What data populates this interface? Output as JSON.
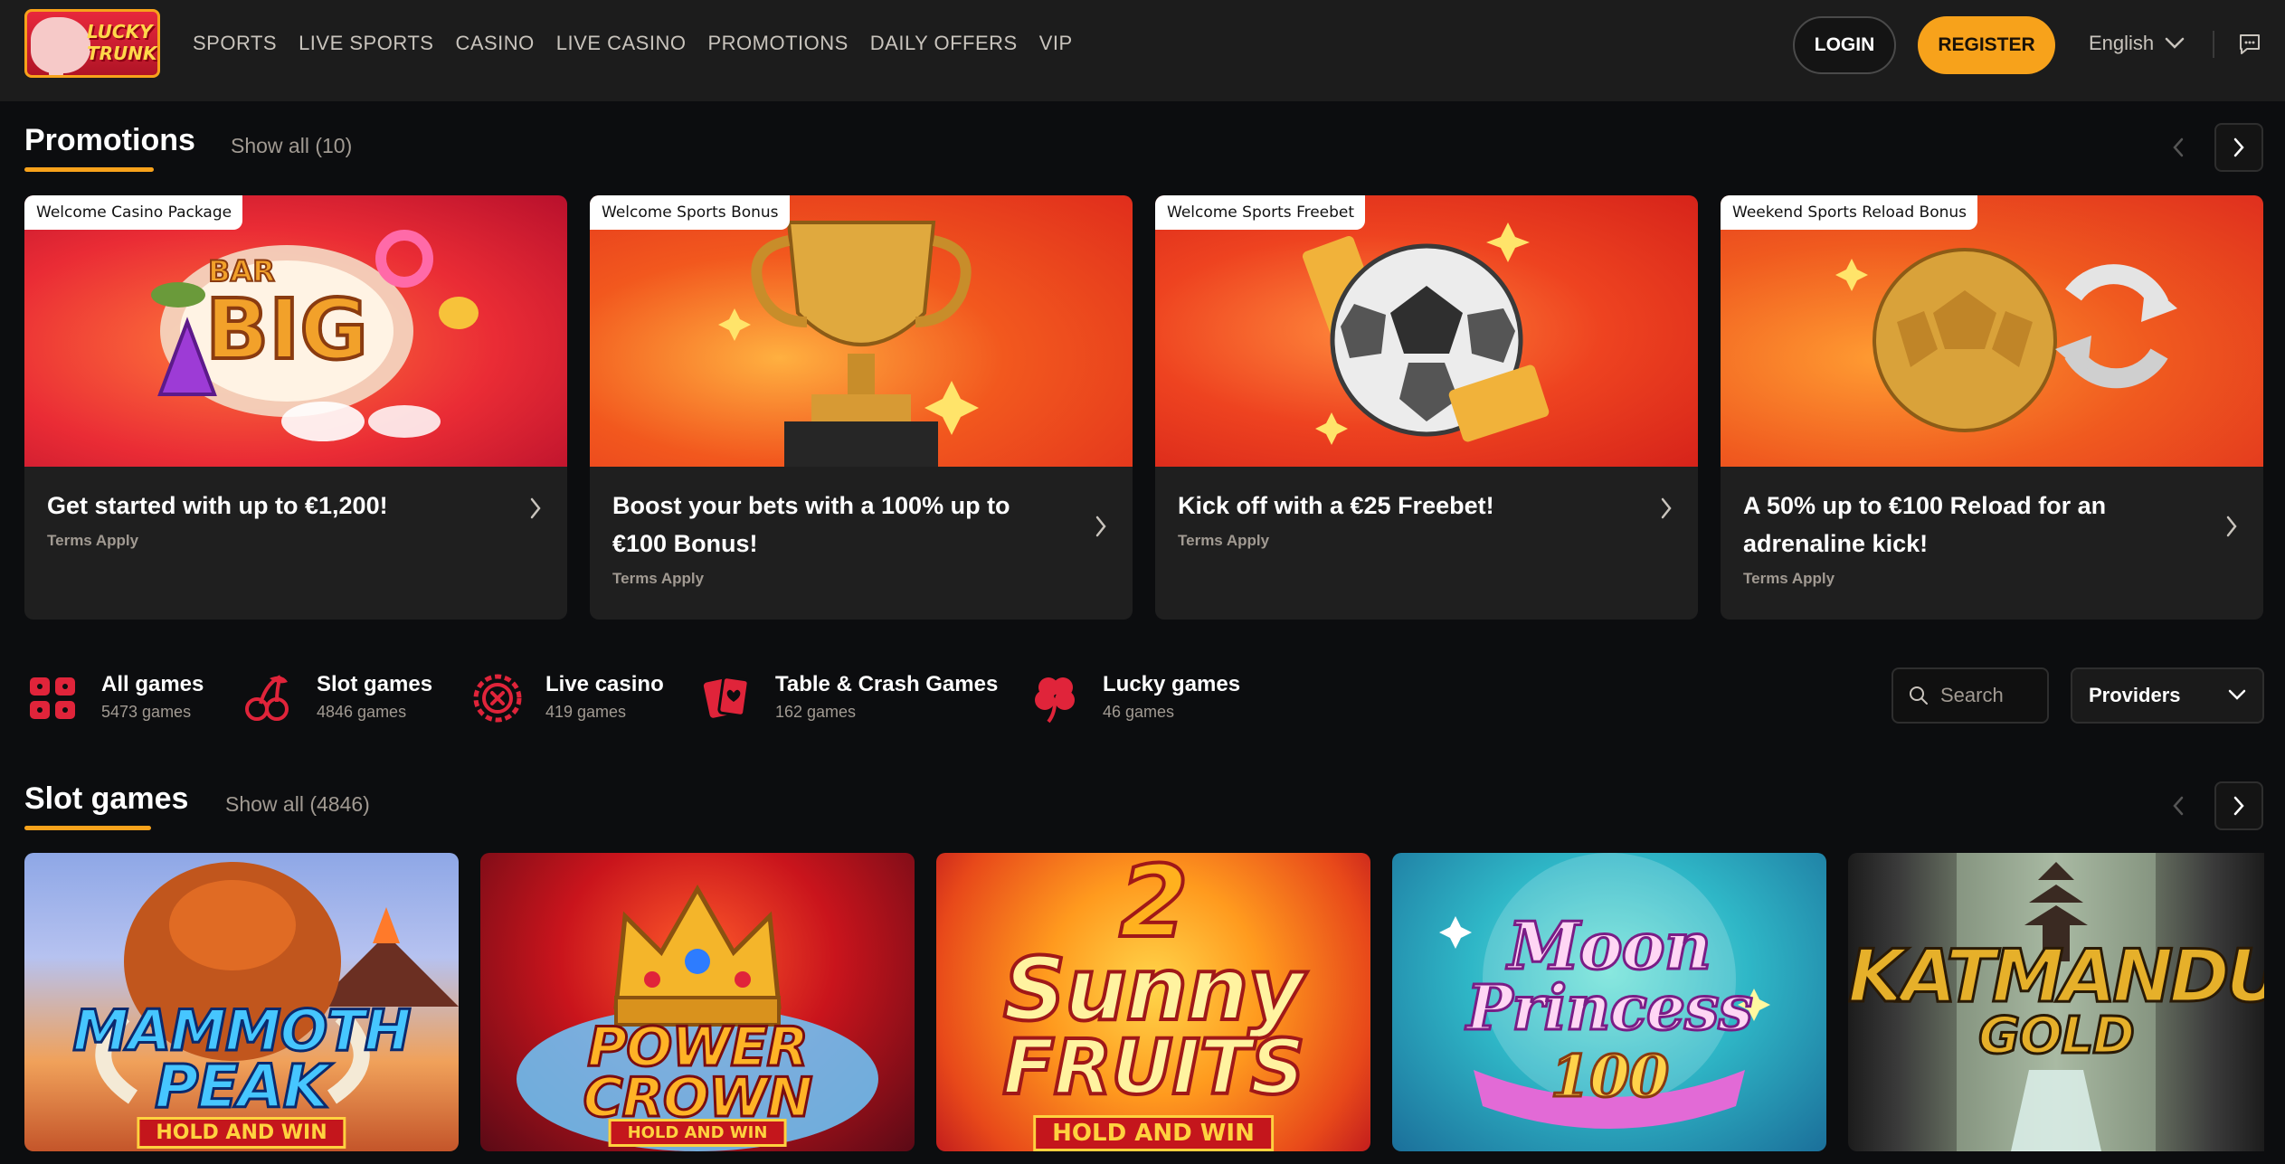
{
  "brand": {
    "logo_text_line1": "LUCKY",
    "logo_text_line2": "TRUNK"
  },
  "nav": [
    {
      "label": "SPORTS"
    },
    {
      "label": "LIVE SPORTS"
    },
    {
      "label": "CASINO"
    },
    {
      "label": "LIVE CASINO"
    },
    {
      "label": "PROMOTIONS"
    },
    {
      "label": "DAILY OFFERS"
    },
    {
      "label": "VIP"
    }
  ],
  "header": {
    "login_label": "LOGIN",
    "register_label": "REGISTER",
    "language": "English"
  },
  "promotions": {
    "title": "Promotions",
    "show_all": "Show all (10)",
    "cards": [
      {
        "tag": "Welcome Casino Package",
        "title": "Get started with up to €1,200!",
        "terms": "Terms Apply"
      },
      {
        "tag": "Welcome Sports Bonus",
        "title": "Boost your bets with a 100% up to €100 Bonus!",
        "terms": "Terms Apply"
      },
      {
        "tag": "Welcome Sports Freebet",
        "title": "Kick off with a €25 Freebet!",
        "terms": "Terms Apply"
      },
      {
        "tag": "Weekend Sports Reload Bonus",
        "title": "A 50% up to €100 Reload for an adrenaline kick!",
        "terms": "Terms Apply"
      }
    ]
  },
  "categories": [
    {
      "name": "All games",
      "count": "5473 games",
      "icon": "grid-dice-icon"
    },
    {
      "name": "Slot games",
      "count": "4846 games",
      "icon": "cherries-icon"
    },
    {
      "name": "Live casino",
      "count": "419 games",
      "icon": "roulette-icon"
    },
    {
      "name": "Table & Crash Games",
      "count": "162 games",
      "icon": "cards-icon"
    },
    {
      "name": "Lucky games",
      "count": "46 games",
      "icon": "clover-icon"
    }
  ],
  "filters": {
    "search_placeholder": "Search",
    "providers_label": "Providers"
  },
  "slots": {
    "title": "Slot games",
    "show_all": "Show all (4846)",
    "games": [
      {
        "line1": "MAMMOTH",
        "line2": "PEAK",
        "badge": "HOLD AND WIN"
      },
      {
        "line1": "POWER",
        "line2": "CROWN",
        "badge": "HOLD AND WIN"
      },
      {
        "line0": "2",
        "line1": "Sunny",
        "line2": "FRUITS",
        "badge": "HOLD AND WIN"
      },
      {
        "line1": "Moon",
        "line2": "Princess",
        "line3": "100"
      },
      {
        "line1": "KATMANDU",
        "line2": "GOLD"
      }
    ]
  },
  "colors": {
    "accent": "#f7a21b",
    "category_icon": "#e0243a",
    "background": "#0c0d0f",
    "header_bg": "#1c1c1c"
  }
}
